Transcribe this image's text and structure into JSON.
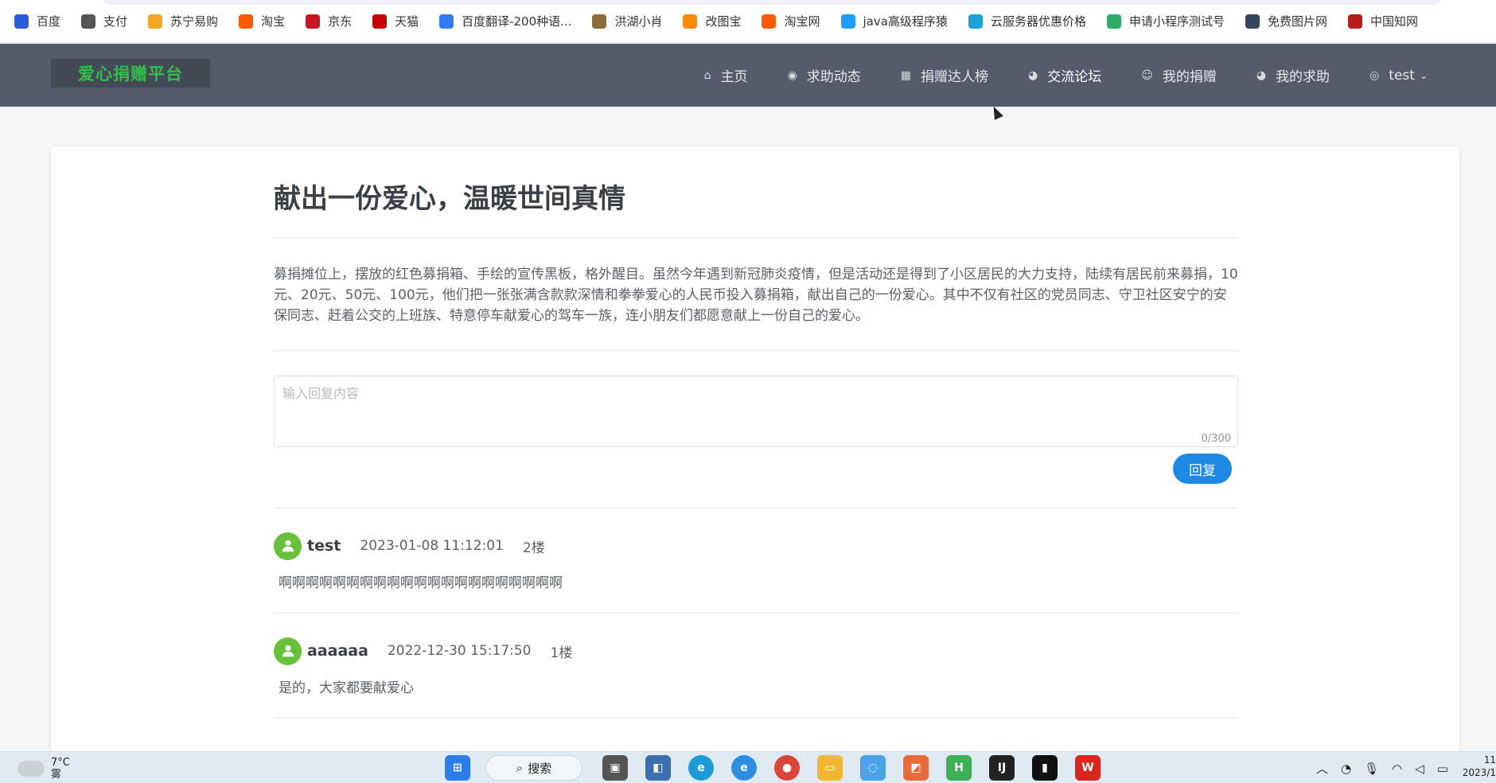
{
  "bookmarks": [
    {
      "label": "百度",
      "icon": "baidu-paw-icon",
      "color": "#2e5bdc"
    },
    {
      "label": "支付",
      "icon": "globe-icon",
      "color": "#555555"
    },
    {
      "label": "苏宁易购",
      "icon": "suning-lion-icon",
      "color": "#f5a623"
    },
    {
      "label": "淘宝",
      "icon": "taobao-icon",
      "color": "#ff5a00"
    },
    {
      "label": "京东",
      "icon": "jd-icon",
      "color": "#c91623"
    },
    {
      "label": "天猫",
      "icon": "tmall-icon",
      "color": "#c40000"
    },
    {
      "label": "百度翻译-200种语...",
      "icon": "translate-icon",
      "color": "#2f7cf6"
    },
    {
      "label": "洪湖小肖",
      "icon": "badge-icon",
      "color": "#8a6d3b"
    },
    {
      "label": "改图宝",
      "icon": "gaitubao-icon",
      "color": "#ff8a00"
    },
    {
      "label": "淘宝网",
      "icon": "taobao-icon",
      "color": "#ff5a00"
    },
    {
      "label": "java高级程序猿",
      "icon": "bilibili-tv-icon",
      "color": "#1e9fff"
    },
    {
      "label": "云服务器优惠价格",
      "icon": "cloud-icon",
      "color": "#1aa3d6"
    },
    {
      "label": "申请小程序测试号",
      "icon": "wechat-icon",
      "color": "#2aae67"
    },
    {
      "label": "免费图片网",
      "icon": "tumblr-icon",
      "color": "#35465c"
    },
    {
      "label": "中国知网",
      "icon": "cnki-icon",
      "color": "#b71c1c"
    }
  ],
  "logo": "爱心捐赠平台",
  "nav": [
    {
      "label": "主页",
      "icon": "home-icon"
    },
    {
      "label": "求助动态",
      "icon": "circle-arrow-icon"
    },
    {
      "label": "捐赠达人榜",
      "icon": "grid-icon"
    },
    {
      "label": "交流论坛",
      "icon": "pie-icon",
      "active": true
    },
    {
      "label": "我的捐赠",
      "icon": "smile-icon"
    },
    {
      "label": "我的求助",
      "icon": "pie-icon"
    },
    {
      "label": "test",
      "icon": "user-circle-icon",
      "dropdown": true
    }
  ],
  "post": {
    "title": "献出一份爱心，温暖世间真情",
    "content": "募捐摊位上，摆放的红色募捐箱、手绘的宣传黑板，格外醒目。虽然今年遇到新冠肺炎疫情，但是活动还是得到了小区居民的大力支持，陆续有居民前来募捐，10元、20元、50元、100元，他们把一张张满含款款深情和拳拳爱心的人民币投入募捐箱，献出自己的一份爱心。其中不仅有社区的党员同志、守卫社区安宁的安保同志、赶着公交的上班族、特意停车献爱心的驾车一族，连小朋友们都愿意献上一份自己的爱心。"
  },
  "reply": {
    "placeholder": "输入回复内容",
    "counter": "0/300",
    "button": "回复"
  },
  "comments": [
    {
      "user": "test",
      "time": "2023-01-08 11:12:01",
      "floor": "2楼",
      "text": "啊啊啊啊啊啊啊啊啊啊啊啊啊啊啊啊啊啊啊啊啊"
    },
    {
      "user": "aaaaaa",
      "time": "2022-12-30 15:17:50",
      "floor": "1楼",
      "text": "是的，大家都要献爱心"
    }
  ],
  "taskbar": {
    "weather_temp": "7°C",
    "weather_desc": "雾",
    "search_label": "搜索",
    "clock_time": "11",
    "clock_date": "2023/1"
  },
  "colors": {
    "nav_bg": "#545c6c",
    "logo_green": "#2fbf4a",
    "button_blue": "#1e88e5",
    "avatar_green": "#67c23a"
  }
}
